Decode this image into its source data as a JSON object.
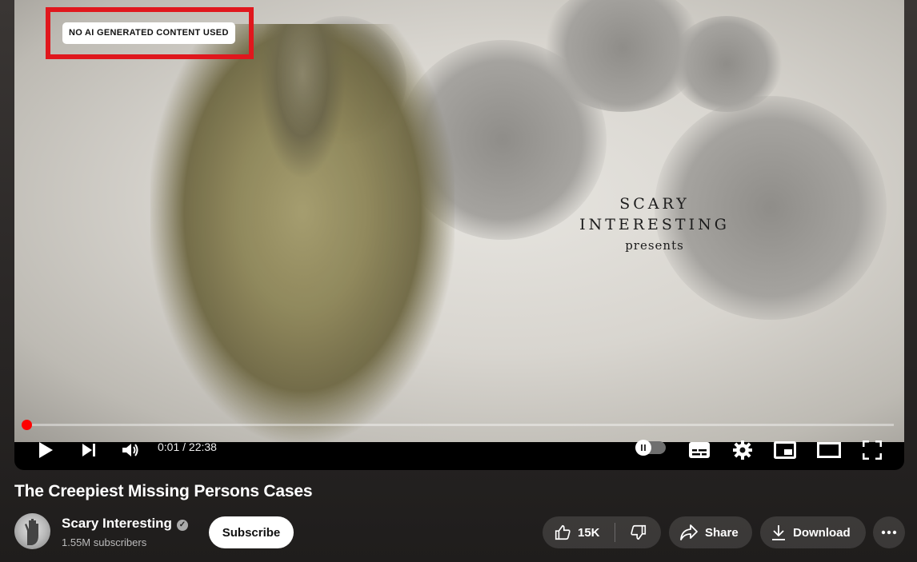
{
  "video": {
    "overlay_badge": "NO AI GENERATED CONTENT USED",
    "overlay_title_line1": "SCARY",
    "overlay_title_line2": "INTERESTING",
    "overlay_title_line3": "presents",
    "progress_fraction": 0.001
  },
  "controls": {
    "time": "0:01 / 22:38",
    "icons": [
      "play-icon",
      "next-icon",
      "volume-icon",
      "autoplay-toggle",
      "subtitles-icon",
      "settings-icon",
      "miniplayer-icon",
      "theater-icon",
      "fullscreen-icon"
    ]
  },
  "meta": {
    "title": "The Creepiest Missing Persons Cases",
    "channel_name": "Scary Interesting",
    "verified_glyph": "✓",
    "subscribers": "1.55M subscribers",
    "subscribe_label": "Subscribe",
    "like_count": "15K",
    "share_label": "Share",
    "download_label": "Download"
  },
  "colors": {
    "accent": "#ff0000",
    "badge_border": "#e0171d",
    "background": "#2a2726"
  }
}
